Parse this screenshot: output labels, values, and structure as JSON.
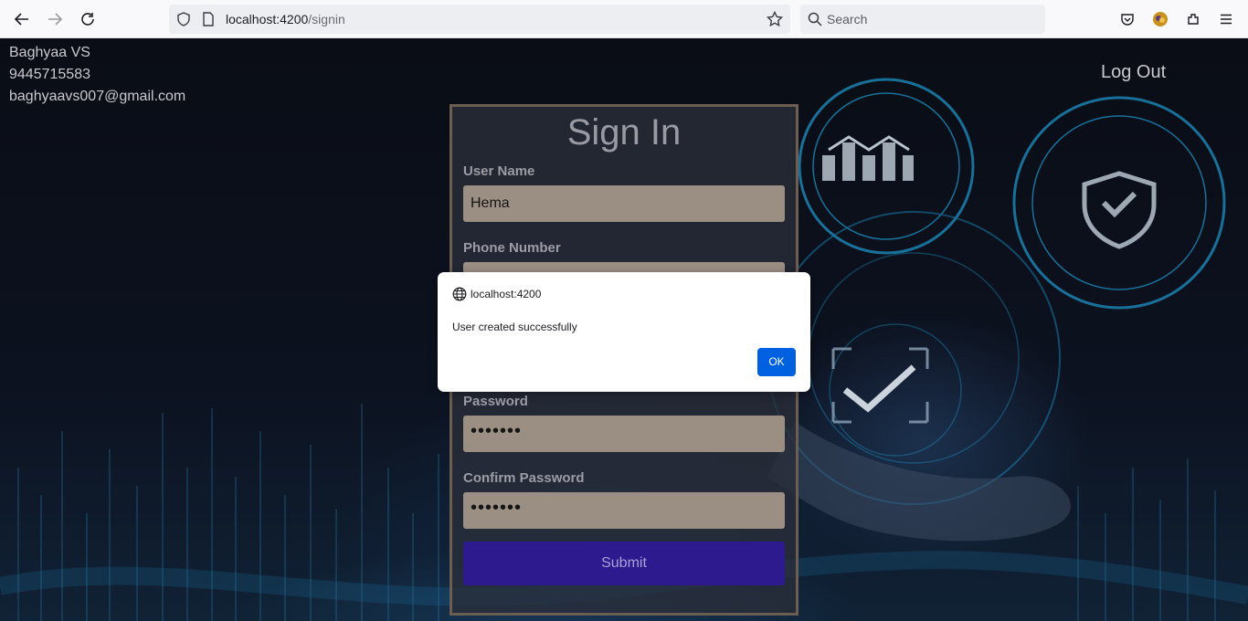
{
  "browser": {
    "url_host": "localhost:4200",
    "url_path": "/signin",
    "search_placeholder": "Search"
  },
  "user": {
    "name": "Baghyaa VS",
    "phone": "9445715583",
    "email": "baghyaavs007@gmail.com"
  },
  "header": {
    "logout_label": "Log Out"
  },
  "signin": {
    "title": "Sign In",
    "username_label": "User Name",
    "username_value": "Hema",
    "phone_label": "Phone Number",
    "password_label": "Password",
    "password_value": "•••••••",
    "confirm_label": "Confirm Password",
    "confirm_value": "•••••••",
    "submit_label": "Submit"
  },
  "dialog": {
    "origin": "localhost:4200",
    "message": "User created successfully",
    "ok_label": "OK"
  },
  "colors": {
    "dialog_ok": "#0061e0",
    "submit_bg": "#2e1a8f",
    "field_bg": "#9b8f84",
    "card_border": "#6c5f52"
  }
}
